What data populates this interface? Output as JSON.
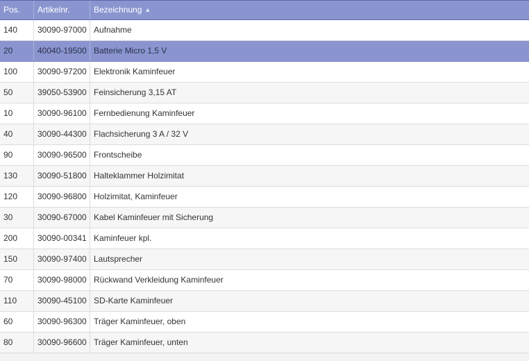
{
  "table": {
    "columns": [
      {
        "key": "pos",
        "label": "Pos."
      },
      {
        "key": "artikelnr",
        "label": "Artikelnr."
      },
      {
        "key": "bezeichnung",
        "label": "Bezeichnung",
        "sorted": "ascending"
      }
    ],
    "sort_icon": "sort-ascending-icon",
    "selected_row_index": 1,
    "colors": {
      "header_bg": "#8a95d0",
      "selected_bg": "#8a95d0",
      "row_bg": "#ffffff",
      "row_alt_bg": "#f6f6f6"
    },
    "rows": [
      {
        "pos": "140",
        "artikelnr": "30090-97000",
        "bezeichnung": "Aufnahme"
      },
      {
        "pos": "20",
        "artikelnr": "40040-19500",
        "bezeichnung": "Batterie Micro 1,5 V"
      },
      {
        "pos": "100",
        "artikelnr": "30090-97200",
        "bezeichnung": "Elektronik Kaminfeuer"
      },
      {
        "pos": "50",
        "artikelnr": "39050-53900",
        "bezeichnung": "Feinsicherung 3,15 AT"
      },
      {
        "pos": "10",
        "artikelnr": "30090-96100",
        "bezeichnung": "Fernbedienung Kaminfeuer"
      },
      {
        "pos": "40",
        "artikelnr": "30090-44300",
        "bezeichnung": "Flachsicherung 3 A / 32 V"
      },
      {
        "pos": "90",
        "artikelnr": "30090-96500",
        "bezeichnung": "Frontscheibe"
      },
      {
        "pos": "130",
        "artikelnr": "30090-51800",
        "bezeichnung": "Halteklammer Holzimitat"
      },
      {
        "pos": "120",
        "artikelnr": "30090-96800",
        "bezeichnung": "Holzimitat, Kaminfeuer"
      },
      {
        "pos": "30",
        "artikelnr": "30090-67000",
        "bezeichnung": "Kabel Kaminfeuer mit Sicherung"
      },
      {
        "pos": "200",
        "artikelnr": "30090-00341",
        "bezeichnung": "Kaminfeuer kpl."
      },
      {
        "pos": "150",
        "artikelnr": "30090-97400",
        "bezeichnung": "Lautsprecher"
      },
      {
        "pos": "70",
        "artikelnr": "30090-98000",
        "bezeichnung": "Rückwand Verkleidung Kaminfeuer"
      },
      {
        "pos": "110",
        "artikelnr": "30090-45100",
        "bezeichnung": "SD-Karte Kaminfeuer"
      },
      {
        "pos": "60",
        "artikelnr": "30090-96300",
        "bezeichnung": "Träger Kaminfeuer, oben"
      },
      {
        "pos": "80",
        "artikelnr": "30090-96600",
        "bezeichnung": "Träger Kaminfeuer, unten"
      }
    ]
  }
}
